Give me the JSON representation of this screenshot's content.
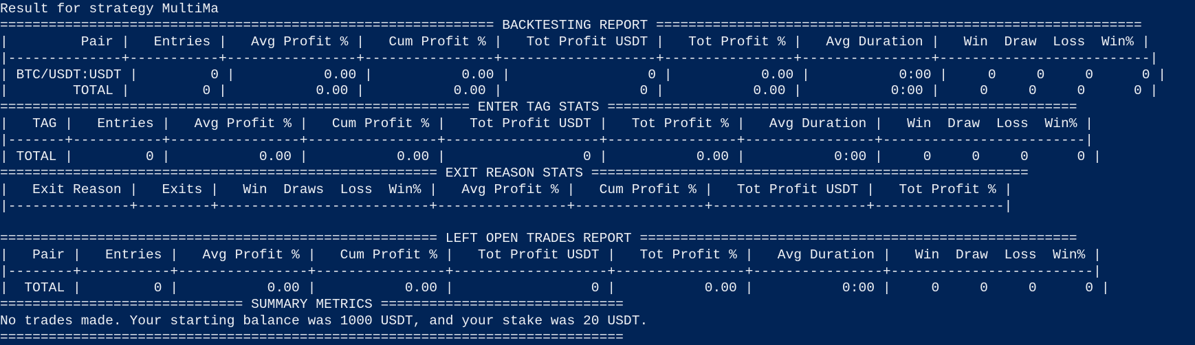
{
  "terminal": {
    "lines": [
      "Result for strategy MultiMa",
      "============================================================= BACKTESTING REPORT ============================================================",
      "|         Pair |   Entries |   Avg Profit % |   Cum Profit % |   Tot Profit USDT |   Tot Profit % |   Avg Duration |   Win  Draw  Loss  Win% |",
      "|--------------+-----------+----------------+----------------+-------------------+----------------+----------------+--------------------------|",
      "| BTC/USDT:USDT |         0 |           0.00 |           0.00 |                 0 |           0.00 |           0:00 |     0     0     0      0 |",
      "|        TOTAL |         0 |           0.00 |           0.00 |                 0 |           0.00 |           0:00 |     0     0     0      0 |",
      "========================================================== ENTER TAG STATS ==========================================================",
      "|   TAG |   Entries |   Avg Profit % |   Cum Profit % |   Tot Profit USDT |   Tot Profit % |   Avg Duration |   Win  Draw  Loss  Win% |",
      "|-------+-----------+----------------+----------------+-------------------+----------------+----------------+-------------------------|",
      "| TOTAL |         0 |           0.00 |           0.00 |                 0 |           0.00 |           0:00 |     0     0     0      0 |",
      "====================================================== EXIT REASON STATS ======================================================",
      "|   Exit Reason |   Exits |   Win  Draws  Loss  Win% |   Avg Profit % |   Cum Profit % |   Tot Profit USDT |   Tot Profit % |",
      "|---------------+---------+--------------------------+----------------+----------------+-------------------+----------------|",
      "",
      "====================================================== LEFT OPEN TRADES REPORT ======================================================",
      "|   Pair |   Entries |   Avg Profit % |   Cum Profit % |   Tot Profit USDT |   Tot Profit % |   Avg Duration |   Win  Draw  Loss  Win% |",
      "|--------+-----------+----------------+----------------+-------------------+----------------+----------------+-------------------------|",
      "|  TOTAL |         0 |           0.00 |           0.00 |                 0 |           0.00 |           0:00 |     0     0     0      0 |",
      "============================== SUMMARY METRICS ==============================",
      "No trades made. Your starting balance was 1000 USDT, and your stake was 20 USDT.",
      "============================================================================="
    ]
  }
}
